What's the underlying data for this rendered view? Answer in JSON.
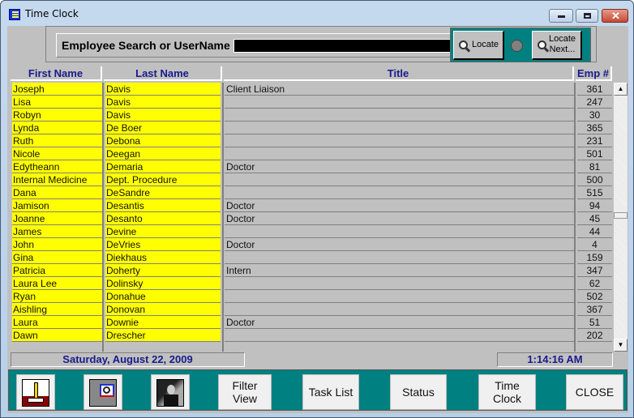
{
  "window": {
    "title": "Time Clock",
    "controls": [
      "minimize",
      "maximize",
      "close"
    ]
  },
  "search": {
    "label": "Employee Search or UserName",
    "value": "",
    "locate_label": "Locate",
    "locate_next_label_line1": "Locate",
    "locate_next_label_line2": "Next...",
    "indicator_color": "#808080"
  },
  "grid": {
    "headers": {
      "first_name": "First Name",
      "last_name": "Last Name",
      "title": "Title",
      "emp_no": "Emp #"
    },
    "rows": [
      {
        "first": "Joseph",
        "last": "Davis",
        "title": "Client Liaison",
        "emp": "361"
      },
      {
        "first": "Lisa",
        "last": "Davis",
        "title": "",
        "emp": "247"
      },
      {
        "first": "Robyn",
        "last": "Davis",
        "title": "",
        "emp": "30"
      },
      {
        "first": "Lynda",
        "last": "De Boer",
        "title": "",
        "emp": "365"
      },
      {
        "first": "Ruth",
        "last": "Debona",
        "title": "",
        "emp": "231"
      },
      {
        "first": "Nicole",
        "last": "Deegan",
        "title": "",
        "emp": "501"
      },
      {
        "first": "Edytheann",
        "last": "Demaria",
        "title": "Doctor",
        "emp": "81"
      },
      {
        "first": "Internal Medicine",
        "last": "Dept. Procedure",
        "title": "",
        "emp": "500"
      },
      {
        "first": "Dana",
        "last": "DeSandre",
        "title": "",
        "emp": "515"
      },
      {
        "first": "Jamison",
        "last": "Desantis",
        "title": "Doctor",
        "emp": "94"
      },
      {
        "first": "Joanne",
        "last": "Desanto",
        "title": "Doctor",
        "emp": "45"
      },
      {
        "first": "James",
        "last": "Devine",
        "title": "",
        "emp": "44"
      },
      {
        "first": "John",
        "last": "DeVries",
        "title": "Doctor",
        "emp": "4"
      },
      {
        "first": "Gina",
        "last": "Diekhaus",
        "title": "",
        "emp": "159"
      },
      {
        "first": "Patricia",
        "last": "Doherty",
        "title": "Intern",
        "emp": "347"
      },
      {
        "first": "Laura Lee",
        "last": "Dolinsky",
        "title": "",
        "emp": "62"
      },
      {
        "first": "Ryan",
        "last": "Donahue",
        "title": "",
        "emp": "502"
      },
      {
        "first": "Aishling",
        "last": "Donovan",
        "title": "",
        "emp": "367"
      },
      {
        "first": "Laura",
        "last": "Downie",
        "title": "Doctor",
        "emp": "51"
      },
      {
        "first": "Dawn",
        "last": "Drescher",
        "title": "",
        "emp": "202"
      }
    ]
  },
  "status": {
    "date": "Saturday, August 22, 2009",
    "time": "1:14:16 AM"
  },
  "toolbar": {
    "icon_buttons": [
      "edit-record-icon",
      "search-record-icon",
      "detective-icon"
    ],
    "filter_view_line1": "Filter",
    "filter_view_line2": "View",
    "task_list": "Task List",
    "status": "Status",
    "time_clock": "Time Clock",
    "close": "CLOSE"
  },
  "colors": {
    "highlight_yellow": "#ffff00",
    "teal": "#008080",
    "header_text": "#1a1a8c",
    "panel_gray": "#c0c0c0"
  }
}
